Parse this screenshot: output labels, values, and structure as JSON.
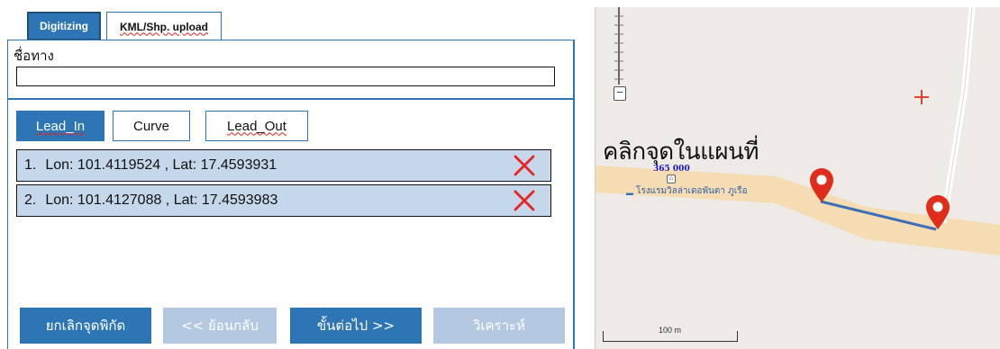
{
  "tabs": [
    {
      "label": "Digitizing",
      "active": true
    },
    {
      "label": "KML/Shp. upload",
      "active": false
    }
  ],
  "route": {
    "label": "ชื่อทาง",
    "value": ""
  },
  "modes": [
    {
      "label": "Lead_In",
      "active": true
    },
    {
      "label": "Curve",
      "active": false
    },
    {
      "label": "Lead_Out",
      "active": false
    }
  ],
  "points": [
    {
      "index": "1.",
      "text": "Lon: 101.4119524 , Lat: 17.4593931",
      "delete_icon": "x-mark-icon"
    },
    {
      "index": "2.",
      "text": "Lon: 101.4127088 , Lat: 17.4593983",
      "delete_icon": "x-mark-icon"
    }
  ],
  "actions": {
    "cancel": "ยกเลิกจุดพิกัด",
    "back": "<< ย้อนกลับ",
    "next": "ขั้นต่อไป >>",
    "analyze": "วิเคราะห์"
  },
  "map": {
    "instruction": "คลิกจุดในแผนที่",
    "elevation_label": "365 000",
    "hotel_label": "โรงแรมวิลล่าเดอพันตา ภูเรือ",
    "scale_label": "100 m",
    "zoom_out": "−"
  },
  "colors": {
    "primary": "#2e75b6",
    "disabled": "#b4c8e1",
    "row_bg": "#c5d7ea",
    "delete": "#e8231f",
    "pin": "#e02d1b",
    "road": "#f6dcb2",
    "route_line": "#3d6fb6"
  }
}
